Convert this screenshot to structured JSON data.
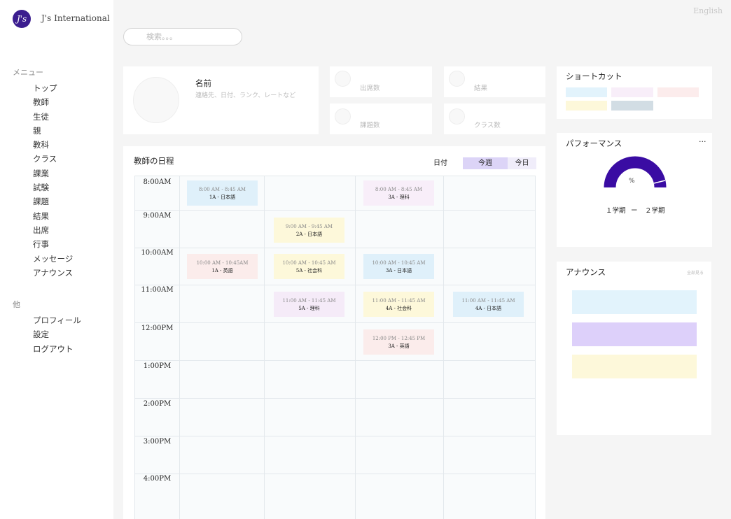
{
  "brand": {
    "logo_text": "J's",
    "name": "J's International"
  },
  "header": {
    "language": "English"
  },
  "search": {
    "placeholder": "検索。。。"
  },
  "sidebar": {
    "menu_label": "メニュー",
    "menu_items": [
      "トップ",
      "教師",
      "生徒",
      "親",
      "教科",
      "クラス",
      "課業",
      "試験",
      "課題",
      "結果",
      "出席",
      "行事",
      "メッセージ",
      "アナウンス"
    ],
    "other_label": "他",
    "other_items": [
      "プロフィール",
      "設定",
      "ログアウト"
    ]
  },
  "profile": {
    "name": "名前",
    "subtitle": "連絡先、日付、ランク、レートなど"
  },
  "stats": [
    "出席数",
    "結果",
    "課題数",
    "クラス数"
  ],
  "schedule": {
    "title": "教師の日程",
    "tabs": [
      "日付",
      "今週",
      "今日"
    ],
    "active_tab": "今週",
    "times": [
      "8:00AM",
      "9:00AM",
      "10:00AM",
      "11:00AM",
      "12:00PM",
      "1:00PM",
      "2:00PM",
      "3:00PM",
      "4:00PM"
    ],
    "events": [
      {
        "row": 0,
        "col": 0,
        "time": "8:00 AM - 8:45 AM",
        "class": "1A - 日本語",
        "color": "#dff0fa"
      },
      {
        "row": 0,
        "col": 2,
        "time": "8:00 AM - 8:45 AM",
        "class": "3A - 理科",
        "color": "#f8eef9"
      },
      {
        "row": 1,
        "col": 1,
        "time": "9:00 AM - 9:45 AM",
        "class": "2A - 日本語",
        "color": "#fdf8da"
      },
      {
        "row": 2,
        "col": 0,
        "time": "10:00 AM - 10:45AM",
        "class": "1A - 英語",
        "color": "#fbeceb"
      },
      {
        "row": 2,
        "col": 1,
        "time": "10:00 AM - 10:45 AM",
        "class": "5A - 社会科",
        "color": "#fdf8da"
      },
      {
        "row": 2,
        "col": 2,
        "time": "10:00 AM - 10:45 AM",
        "class": "3A - 日本語",
        "color": "#dff0fa"
      },
      {
        "row": 3,
        "col": 1,
        "time": "11:00 AM - 11:45 AM",
        "class": "5A - 理科",
        "color": "#f5ebf8"
      },
      {
        "row": 3,
        "col": 2,
        "time": "11:00 AM - 11:45 AM",
        "class": "4A - 社会科",
        "color": "#fdf8da"
      },
      {
        "row": 3,
        "col": 3,
        "time": "11:00 AM - 11:45 AM",
        "class": "4A - 日本語",
        "color": "#dff0fa"
      },
      {
        "row": 4,
        "col": 2,
        "time": "12:00 PM - 12:45 PM",
        "class": "3A - 英語",
        "color": "#fbeceb"
      }
    ]
  },
  "shortcuts": {
    "title": "ショートカット",
    "colors": [
      "#e2f3fc",
      "#f8eef9",
      "#fcecec",
      "#fdf8da",
      "#d2dde4"
    ]
  },
  "performance": {
    "title": "パフォーマンス",
    "menu": "···",
    "gauge_label": "%",
    "legend_1": "１学期",
    "legend_sep": "ー",
    "legend_2": "２学期",
    "gauge_color": "#3a0ca3"
  },
  "announcements": {
    "title": "アナウンス",
    "see_all": "全部見る",
    "colors": [
      "#e2f3fc",
      "#ddd0fa",
      "#fdf8da"
    ]
  }
}
